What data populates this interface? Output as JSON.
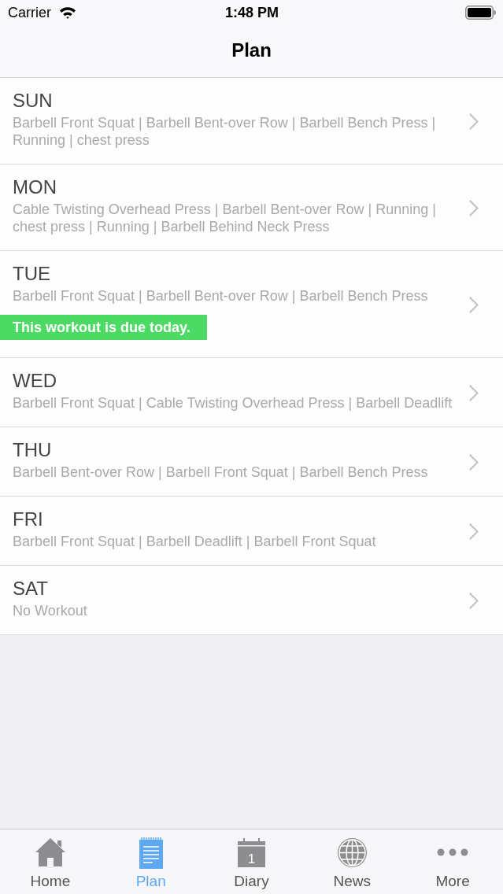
{
  "status_bar": {
    "carrier": "Carrier",
    "time": "1:48 PM"
  },
  "nav_bar": {
    "title": "Plan"
  },
  "days": [
    {
      "day": "SUN",
      "exercises": "Barbell Front Squat | Barbell Bent-over Row | Barbell Bench Press | Running | chest press"
    },
    {
      "day": "MON",
      "exercises": "Cable Twisting Overhead Press | Barbell Bent-over Row | Running | chest press | Running | Barbell Behind Neck Press"
    },
    {
      "day": "TUE",
      "exercises": "Barbell Front Squat | Barbell Bent-over Row | Barbell Bench Press",
      "notice": "This workout is due today."
    },
    {
      "day": "WED",
      "exercises": "Barbell Front Squat | Cable Twisting Overhead Press | Barbell Deadlift"
    },
    {
      "day": "THU",
      "exercises": "Barbell Bent-over Row | Barbell Front Squat | Barbell Bench Press"
    },
    {
      "day": "FRI",
      "exercises": "Barbell Front Squat | Barbell Deadlift | Barbell Front Squat"
    },
    {
      "day": "SAT",
      "exercises": "No Workout"
    }
  ],
  "tab_bar": [
    {
      "kind": "home",
      "label": "Home",
      "selected": false
    },
    {
      "kind": "notepad",
      "label": "Plan",
      "selected": true
    },
    {
      "kind": "calendar",
      "label": "Diary",
      "selected": false,
      "icon_text": "1"
    },
    {
      "kind": "globe",
      "label": "News",
      "selected": false
    },
    {
      "kind": "dots",
      "label": "More",
      "selected": false
    }
  ]
}
